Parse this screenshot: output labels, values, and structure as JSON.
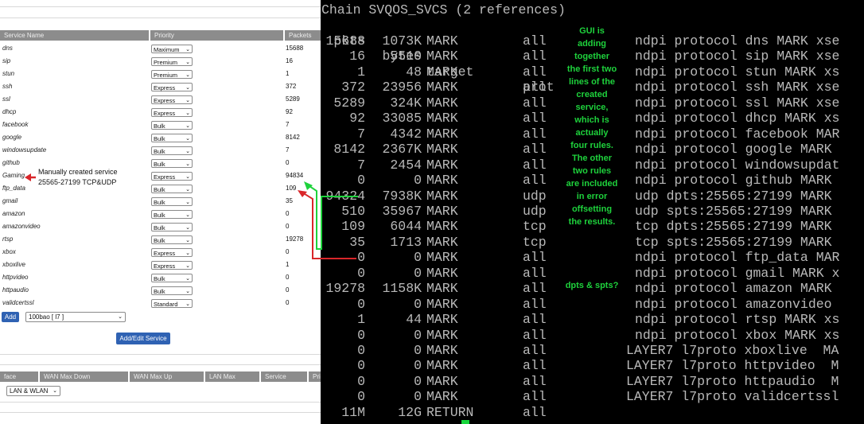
{
  "gui": {
    "headers": {
      "service": "Service Name",
      "priority": "Priority",
      "packets": "Packets"
    },
    "rows": [
      {
        "name": "dns",
        "priority": "Maximum",
        "packets": "15688"
      },
      {
        "name": "sip",
        "priority": "Premium",
        "packets": "16"
      },
      {
        "name": "stun",
        "priority": "Premium",
        "packets": "1"
      },
      {
        "name": "ssh",
        "priority": "Express",
        "packets": "372"
      },
      {
        "name": "ssl",
        "priority": "Express",
        "packets": "5289"
      },
      {
        "name": "dhcp",
        "priority": "Express",
        "packets": "92"
      },
      {
        "name": "facebook",
        "priority": "Bulk",
        "packets": "7"
      },
      {
        "name": "google",
        "priority": "Bulk",
        "packets": "8142"
      },
      {
        "name": "windowsupdate",
        "priority": "Bulk",
        "packets": "7"
      },
      {
        "name": "github",
        "priority": "Bulk",
        "packets": "0"
      },
      {
        "name": "Gaming",
        "priority": "Express",
        "packets": "94834"
      },
      {
        "name": "ftp_data",
        "priority": "Bulk",
        "packets": "109"
      },
      {
        "name": "gmail",
        "priority": "Bulk",
        "packets": "35"
      },
      {
        "name": "amazon",
        "priority": "Bulk",
        "packets": "0"
      },
      {
        "name": "amazonvideo",
        "priority": "Bulk",
        "packets": "0"
      },
      {
        "name": "rtsp",
        "priority": "Bulk",
        "packets": "19278"
      },
      {
        "name": "xbox",
        "priority": "Express",
        "packets": "0"
      },
      {
        "name": "xboxlive",
        "priority": "Express",
        "packets": "1"
      },
      {
        "name": "httpvideo",
        "priority": "Bulk",
        "packets": "0"
      },
      {
        "name": "httpaudio",
        "priority": "Bulk",
        "packets": "0"
      },
      {
        "name": "validcertssl",
        "priority": "Standard",
        "packets": "0"
      }
    ],
    "add_label": "Add",
    "add_select_value": "100bao [ l7 ]",
    "add_edit_label": "Add/Edit Service",
    "bottom_headers": {
      "iface": "face",
      "wan_down": "WAN Max Down",
      "wan_up": "WAN Max Up",
      "lan_max": "LAN Max",
      "service": "Service",
      "pr": "Pri"
    },
    "iface_select_value": "LAN & WLAN",
    "annotation_line1": "Manually created service",
    "annotation_line2": "25565-27199 TCP&UDP"
  },
  "terminal": {
    "title_line": "Chain SVQOS_SVCS (2 references)",
    "header": {
      "pkts": "pkts",
      "bytes": "bytes",
      "target": "target",
      "prot": "prot"
    },
    "rows": [
      {
        "pkts": "15688",
        "bytes": "1073K",
        "target": "MARK",
        "prot": "all",
        "extra": "ndpi protocol dns MARK xse"
      },
      {
        "pkts": "16",
        "bytes": "5510",
        "target": "MARK",
        "prot": "all",
        "extra": "ndpi protocol sip MARK xse"
      },
      {
        "pkts": "1",
        "bytes": "48",
        "target": "MARK",
        "prot": "all",
        "extra": "ndpi protocol stun MARK xs"
      },
      {
        "pkts": "372",
        "bytes": "23956",
        "target": "MARK",
        "prot": "all",
        "extra": "ndpi protocol ssh MARK xse"
      },
      {
        "pkts": "5289",
        "bytes": "324K",
        "target": "MARK",
        "prot": "all",
        "extra": "ndpi protocol ssl MARK xse"
      },
      {
        "pkts": "92",
        "bytes": "33085",
        "target": "MARK",
        "prot": "all",
        "extra": "ndpi protocol dhcp MARK xs"
      },
      {
        "pkts": "7",
        "bytes": "4342",
        "target": "MARK",
        "prot": "all",
        "extra": "ndpi protocol facebook MAR"
      },
      {
        "pkts": "8142",
        "bytes": "2367K",
        "target": "MARK",
        "prot": "all",
        "extra": "ndpi protocol google MARK"
      },
      {
        "pkts": "7",
        "bytes": "2454",
        "target": "MARK",
        "prot": "all",
        "extra": "ndpi protocol windowsupdat"
      },
      {
        "pkts": "0",
        "bytes": "0",
        "target": "MARK",
        "prot": "all",
        "extra": "ndpi protocol github MARK"
      },
      {
        "pkts": "94324",
        "bytes": "7938K",
        "target": "MARK",
        "prot": "udp",
        "extra": "udp dpts:25565:27199 MARK"
      },
      {
        "pkts": "510",
        "bytes": "35967",
        "target": "MARK",
        "prot": "udp",
        "extra": "udp spts:25565:27199 MARK"
      },
      {
        "pkts": "109",
        "bytes": "6044",
        "target": "MARK",
        "prot": "tcp",
        "extra": "tcp dpts:25565:27199 MARK"
      },
      {
        "pkts": "35",
        "bytes": "1713",
        "target": "MARK",
        "prot": "tcp",
        "extra": "tcp spts:25565:27199 MARK"
      },
      {
        "pkts": "0",
        "bytes": "0",
        "target": "MARK",
        "prot": "all",
        "extra": "ndpi protocol ftp_data MAR"
      },
      {
        "pkts": "0",
        "bytes": "0",
        "target": "MARK",
        "prot": "all",
        "extra": "ndpi protocol gmail MARK x"
      },
      {
        "pkts": "19278",
        "bytes": "1158K",
        "target": "MARK",
        "prot": "all",
        "extra": "ndpi protocol amazon MARK"
      },
      {
        "pkts": "0",
        "bytes": "0",
        "target": "MARK",
        "prot": "all",
        "extra": "ndpi protocol amazonvideo"
      },
      {
        "pkts": "1",
        "bytes": "44",
        "target": "MARK",
        "prot": "all",
        "extra": "ndpi protocol rtsp MARK xs"
      },
      {
        "pkts": "0",
        "bytes": "0",
        "target": "MARK",
        "prot": "all",
        "extra": "ndpi protocol xbox MARK xs"
      },
      {
        "pkts": "0",
        "bytes": "0",
        "target": "MARK",
        "prot": "all",
        "extra": "LAYER7 l7proto xboxlive  MA"
      },
      {
        "pkts": "0",
        "bytes": "0",
        "target": "MARK",
        "prot": "all",
        "extra": "LAYER7 l7proto httpvideo  M"
      },
      {
        "pkts": "0",
        "bytes": "0",
        "target": "MARK",
        "prot": "all",
        "extra": "LAYER7 l7proto httpaudio  M"
      },
      {
        "pkts": "0",
        "bytes": "0",
        "target": "MARK",
        "prot": "all",
        "extra": "LAYER7 l7proto validcertssl"
      },
      {
        "pkts": "11M",
        "bytes": "12G",
        "target": "RETURN",
        "prot": "all",
        "extra": ""
      }
    ],
    "note_lines": [
      "GUI is",
      "adding",
      "together",
      "the first two",
      "lines of the",
      "created",
      "service,",
      "which is",
      "actually",
      "four rules.",
      "The other",
      "two rules",
      "are included",
      "in error",
      "offsetting",
      "the results."
    ],
    "note2": "dpts & spts?"
  },
  "colors": {
    "term_bg": "#000000",
    "term_fg": "#b9b9b9",
    "note_green": "#1ed23c",
    "gui_header": "#8c8c8c",
    "button_blue": "#2f62b3",
    "arrow_red": "#d9262a",
    "arrow_green": "#1ed23c"
  }
}
